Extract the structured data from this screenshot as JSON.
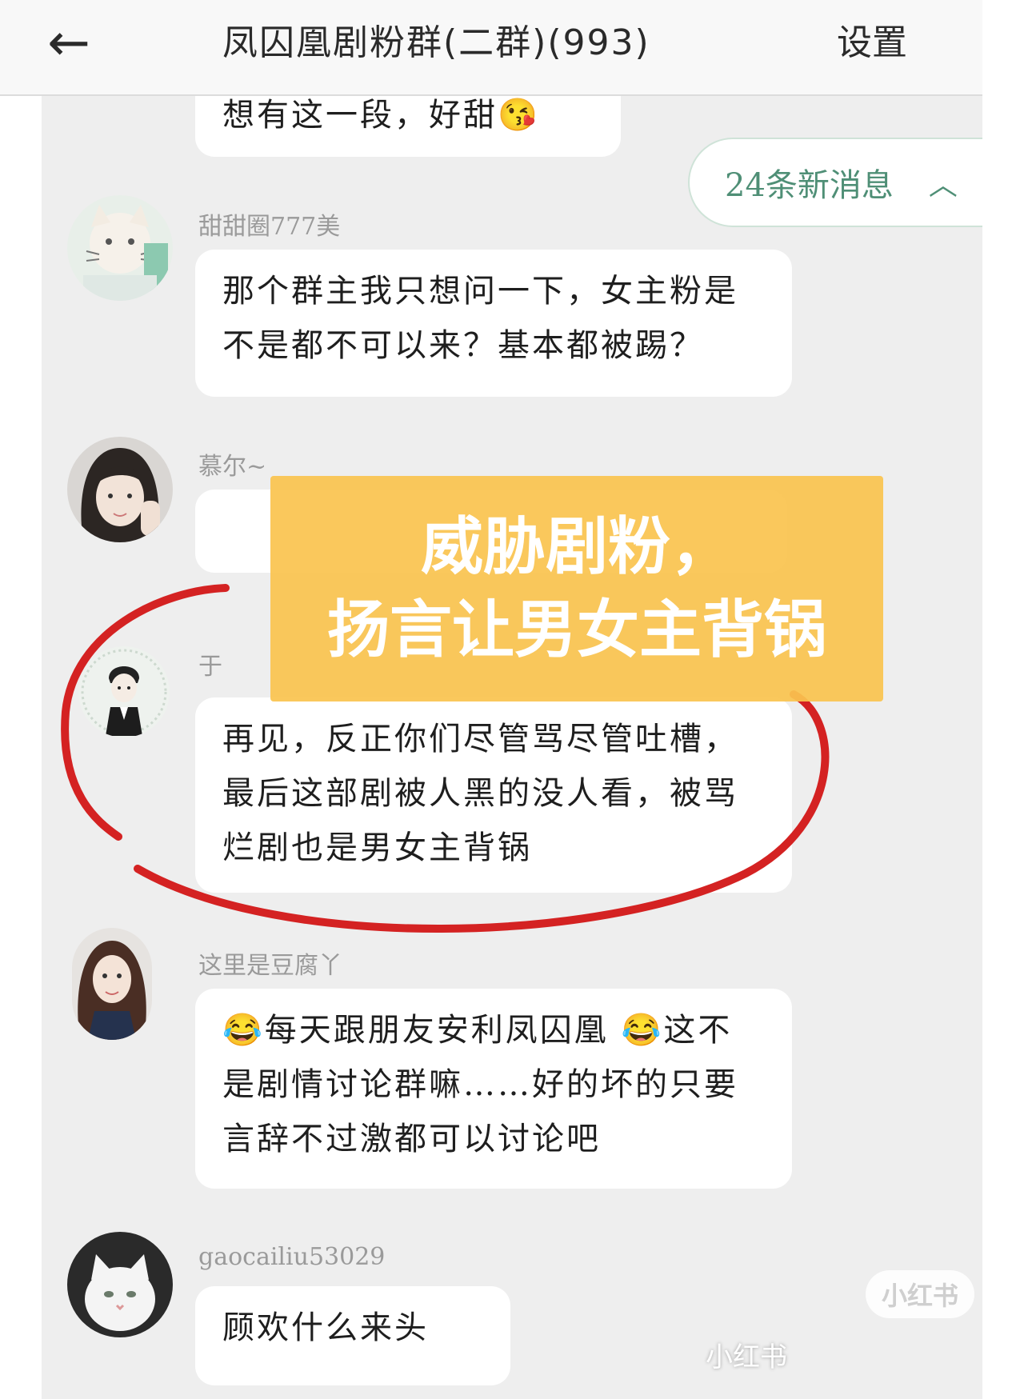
{
  "header": {
    "title": "凤囚凰剧粉群(二群)(993)",
    "back_icon": "back-arrow-icon",
    "settings_label": "设置"
  },
  "new_messages_label": "24条新消息",
  "messages": [
    {
      "sender": "",
      "text": "想有这一段，好甜😘"
    },
    {
      "sender": "甜甜圈777美",
      "text": "那个群主我只想问一下，女主粉是不是都不可以来？基本都被踢？"
    },
    {
      "sender": "慕尔~",
      "text": ""
    },
    {
      "sender": "于",
      "text": "再见，反正你们尽管骂尽管吐槽，最后这部剧被人黑的没人看，被骂烂剧也是男女主背锅"
    },
    {
      "sender": "这里是豆腐丫",
      "text": "😂每天跟朋友安利凤囚凰 😂这不是剧情讨论群嘛……好的坏的只要言辞不过激都可以讨论吧"
    },
    {
      "sender": "gaocailiu53029",
      "text": "顾欢什么来头"
    }
  ],
  "caption": {
    "line1": "威胁剧粉，",
    "line2": "扬言让男女主背锅"
  },
  "watermark": {
    "badge": "小红书",
    "text": "小红书"
  },
  "colors": {
    "caption_bg": "#fac450",
    "highlight_circle": "#d42222",
    "new_msg_text": "#4f8f76"
  }
}
